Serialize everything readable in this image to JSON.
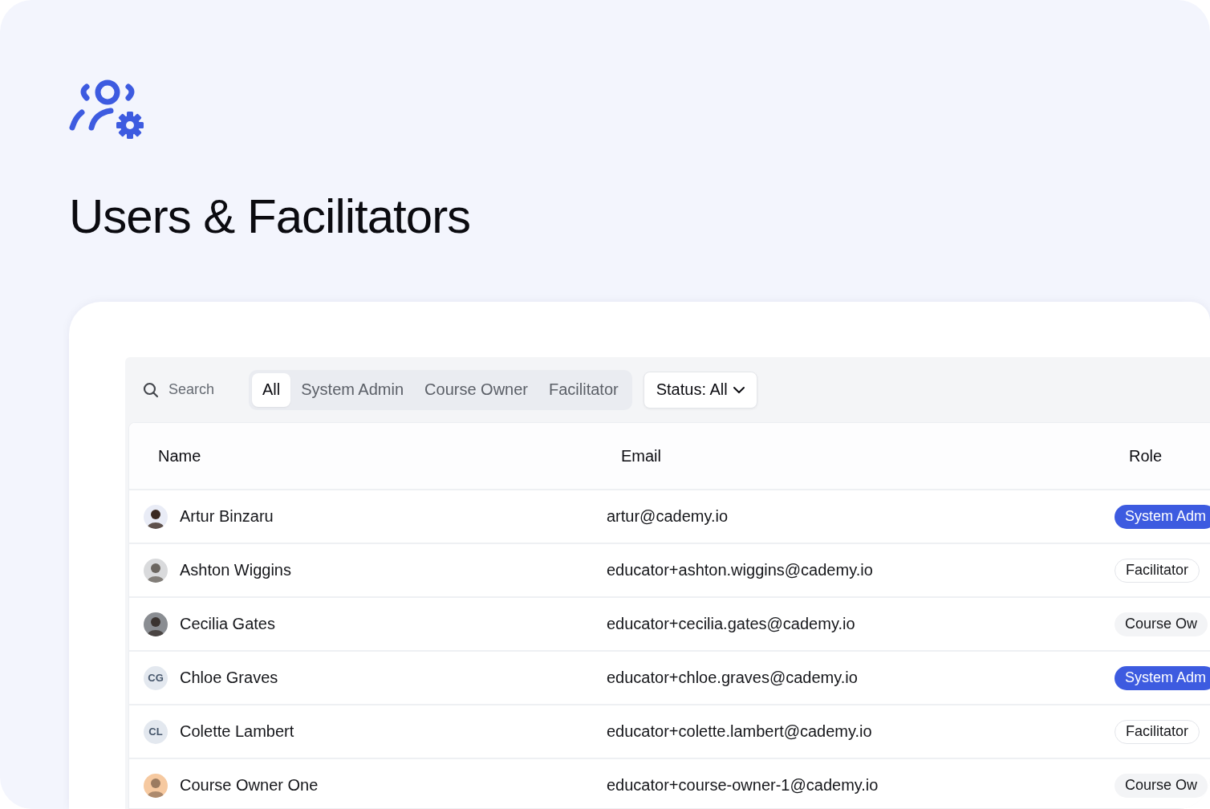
{
  "page": {
    "title": "Users & Facilitators"
  },
  "toolbar": {
    "search": {
      "placeholder": "Search"
    },
    "role_tabs": [
      {
        "label": "All",
        "selected": true
      },
      {
        "label": "System Admin",
        "selected": false
      },
      {
        "label": "Course Owner",
        "selected": false
      },
      {
        "label": "Facilitator",
        "selected": false
      }
    ],
    "status_filter": {
      "label": "Status: All"
    }
  },
  "table": {
    "columns": [
      "Name",
      "Email",
      "Role"
    ],
    "rows": [
      {
        "name": "Artur Binzaru",
        "email": "artur@cademy.io",
        "role": {
          "kind": "admin",
          "label": "System Adm"
        }
      },
      {
        "name": "Ashton Wiggins",
        "email": "educator+ashton.wiggins@cademy.io",
        "role": {
          "kind": "facilitator",
          "label": "Facilitator"
        }
      },
      {
        "name": "Cecilia Gates",
        "email": "educator+cecilia.gates@cademy.io",
        "role": {
          "kind": "owner",
          "label": "Course Ow"
        }
      },
      {
        "avatar": {
          "kind": "initials",
          "text": "CG"
        },
        "name": "Chloe Graves",
        "email": "educator+chloe.graves@cademy.io",
        "role": {
          "kind": "admin",
          "label": "System Adm"
        }
      },
      {
        "avatar": {
          "kind": "initials",
          "text": "CL"
        },
        "name": "Colette Lambert",
        "email": "educator+colette.lambert@cademy.io",
        "role": {
          "kind": "facilitator",
          "label": "Facilitator"
        }
      },
      {
        "name": "Course Owner One",
        "email": "educator+course-owner-1@cademy.io",
        "role": {
          "kind": "owner",
          "label": "Course Ow"
        }
      }
    ]
  }
}
